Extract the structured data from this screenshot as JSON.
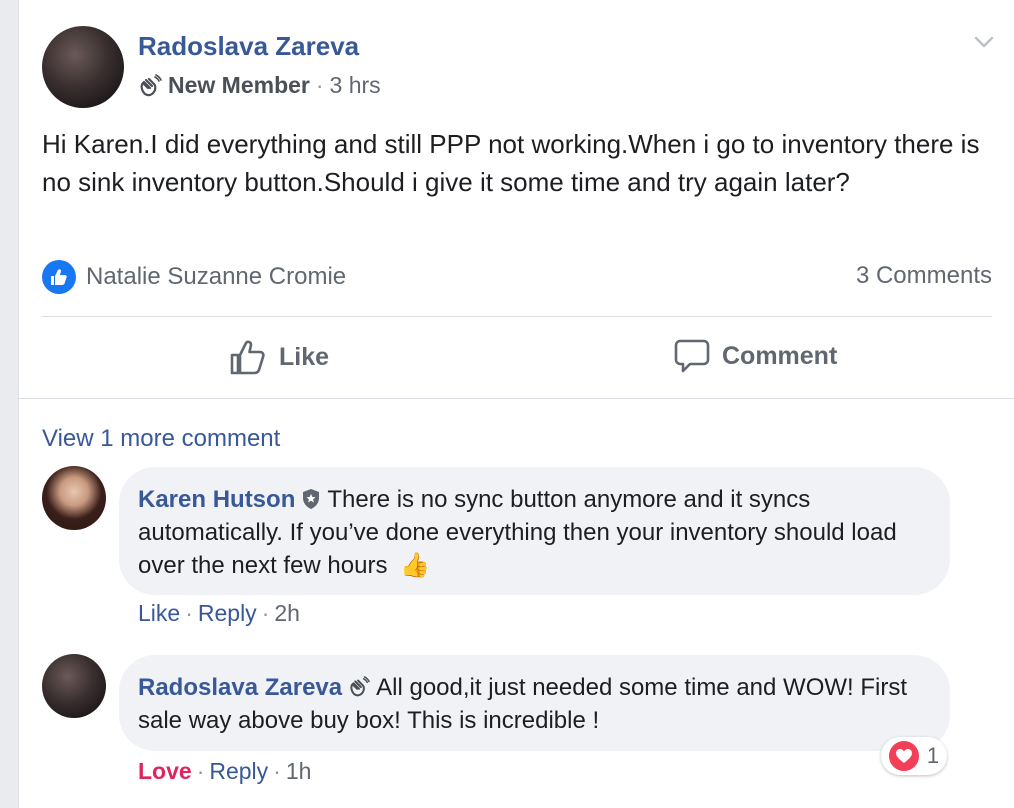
{
  "post": {
    "author": "Radoslava Zareva",
    "badge": "New Member",
    "time": "3 hrs",
    "text": "Hi Karen.I did everything and still PPP not working.When i go to inventory there is no sink inventory button.Should i give it some time and try again later?",
    "reactor": "Natalie Suzanne Cromie",
    "comments_count": "3 Comments"
  },
  "actions": {
    "like": "Like",
    "comment": "Comment"
  },
  "view_more": "View 1 more comment",
  "comments": [
    {
      "author": "Karen Hutson",
      "text": "There is no sync button anymore and it syncs automatically. If you’ve done everything then your inventory should load over the next few hours",
      "emoji": "👍",
      "like": "Like",
      "reply": "Reply",
      "time": "2h"
    },
    {
      "author": "Radoslava Zareva",
      "text": "All good,it just needed some time and WOW! First sale way above buy box! This is incredible !",
      "like": "Love",
      "reply": "Reply",
      "time": "1h",
      "reaction_count": "1"
    }
  ],
  "colors": {
    "link": "#385898",
    "love": "#e0245e",
    "like_blue": "#1877f2"
  }
}
